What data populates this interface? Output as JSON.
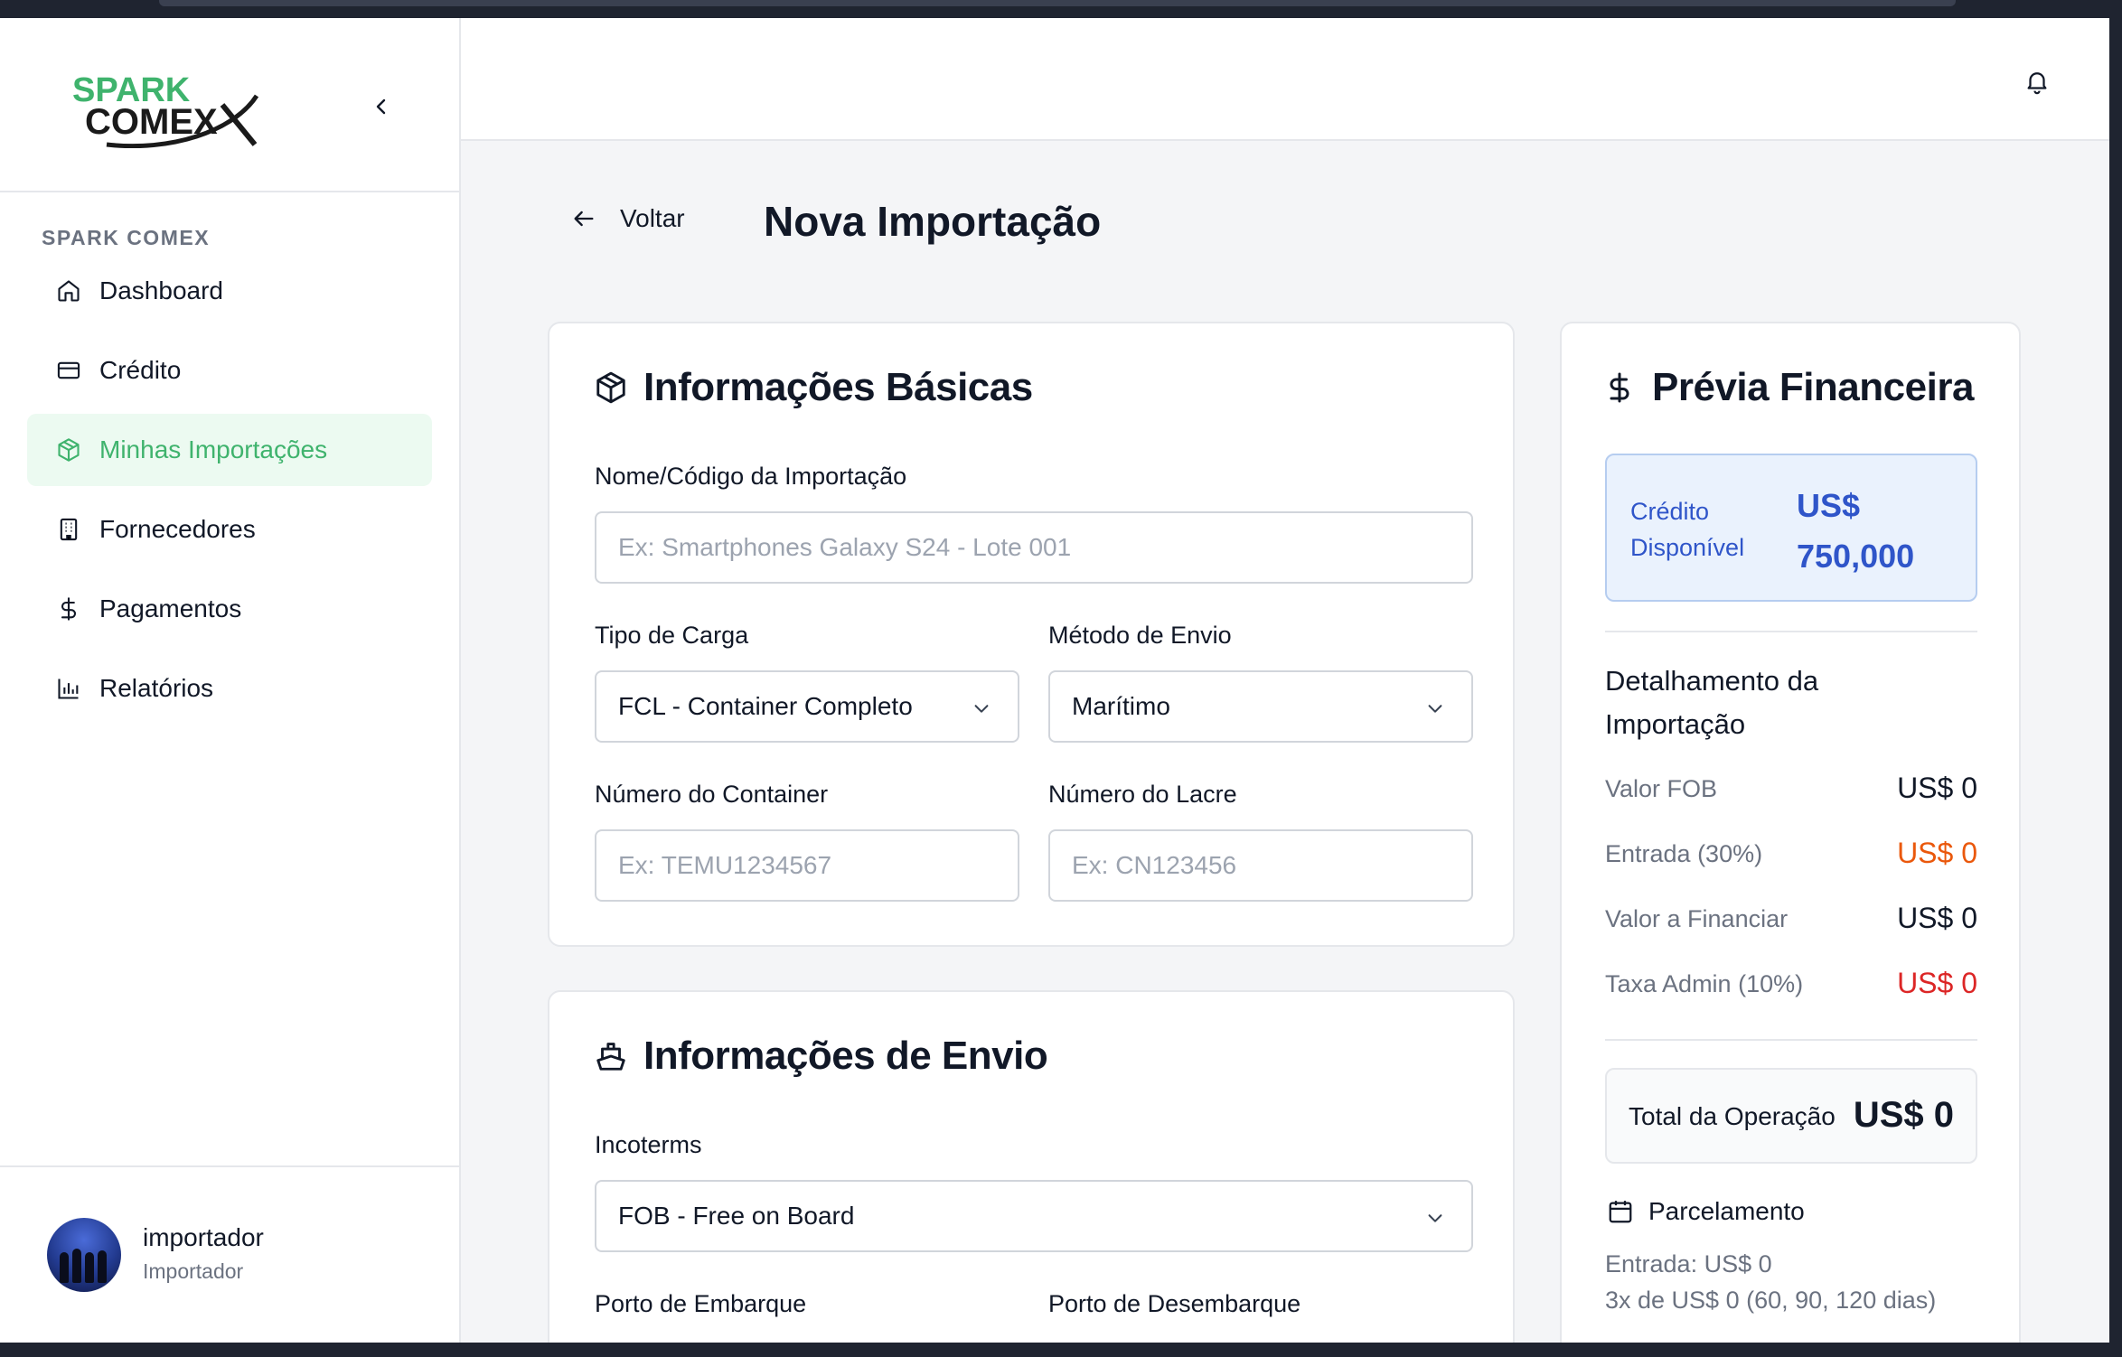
{
  "brand": {
    "logo_line1": "SPARK",
    "logo_line2": "COMEX",
    "color_green": "#3fb36d",
    "color_dark": "#1a1a1a"
  },
  "sidebar": {
    "section_label": "SPARK COMEX",
    "collapse_icon": "chevron-left-icon",
    "items": [
      {
        "label": "Dashboard",
        "icon": "home-icon",
        "active": false
      },
      {
        "label": "Crédito",
        "icon": "credit-card-icon",
        "active": false
      },
      {
        "label": "Minhas Importações",
        "icon": "package-icon",
        "active": true
      },
      {
        "label": "Fornecedores",
        "icon": "building-icon",
        "active": false
      },
      {
        "label": "Pagamentos",
        "icon": "dollar-icon",
        "active": false
      },
      {
        "label": "Relatórios",
        "icon": "bar-chart-icon",
        "active": false
      }
    ],
    "user": {
      "name": "importador",
      "role": "Importador"
    }
  },
  "topbar": {
    "bell_icon": "bell-icon"
  },
  "header": {
    "back_label": "Voltar",
    "title": "Nova Importação"
  },
  "basic_info": {
    "title": "Informações Básicas",
    "name_label": "Nome/Código da Importação",
    "name_placeholder": "Ex: Smartphones Galaxy S24 - Lote 001",
    "cargo_label": "Tipo de Carga",
    "cargo_value": "FCL - Container Completo",
    "method_label": "Método de Envio",
    "method_value": "Marítimo",
    "container_label": "Número do Container",
    "container_placeholder": "Ex: TEMU1234567",
    "seal_label": "Número do Lacre",
    "seal_placeholder": "Ex: CN123456"
  },
  "shipping_info": {
    "title": "Informações de Envio",
    "incoterms_label": "Incoterms",
    "incoterms_value": "FOB - Free on Board",
    "port_origin_label": "Porto de Embarque",
    "port_dest_label": "Porto de Desembarque"
  },
  "financial": {
    "title": "Prévia Financeira",
    "credit_label": "Crédito Disponível",
    "credit_value": "US$ 750,000",
    "detail_title": "Detalhamento da Importação",
    "rows": [
      {
        "label": "Valor FOB",
        "value": "US$ 0",
        "color": "#111827"
      },
      {
        "label": "Entrada (30%)",
        "value": "US$ 0",
        "color": "#ea580c"
      },
      {
        "label": "Valor a Financiar",
        "value": "US$ 0",
        "color": "#111827"
      },
      {
        "label": "Taxa Admin (10%)",
        "value": "US$ 0",
        "color": "#dc2626"
      }
    ],
    "total_label": "Total da Operação",
    "total_value": "US$ 0",
    "parcel_title": "Parcelamento",
    "parcel_line1": "Entrada: US$ 0",
    "parcel_line2": "3x de US$ 0 (60, 90, 120 dias)"
  }
}
